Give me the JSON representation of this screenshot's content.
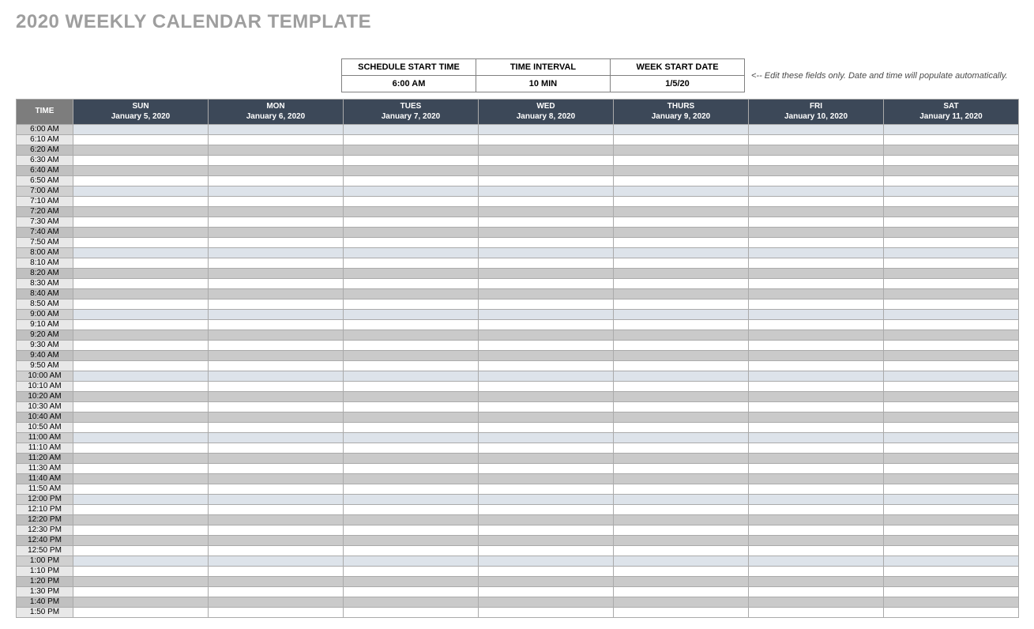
{
  "title": "2020 WEEKLY CALENDAR TEMPLATE",
  "config": {
    "headers": [
      "SCHEDULE START TIME",
      "TIME INTERVAL",
      "WEEK START DATE"
    ],
    "values": [
      "6:00 AM",
      "10 MIN",
      "1/5/20"
    ],
    "hint": "<-- Edit these fields only. Date and time will populate automatically."
  },
  "columns": [
    {
      "label": "TIME",
      "date": ""
    },
    {
      "label": "SUN",
      "date": "January 5, 2020"
    },
    {
      "label": "MON",
      "date": "January 6, 2020"
    },
    {
      "label": "TUES",
      "date": "January 7, 2020"
    },
    {
      "label": "WED",
      "date": "January 8, 2020"
    },
    {
      "label": "THURS",
      "date": "January 9, 2020"
    },
    {
      "label": "FRI",
      "date": "January 10, 2020"
    },
    {
      "label": "SAT",
      "date": "January 11, 2020"
    }
  ],
  "times": [
    "6:00 AM",
    "6:10 AM",
    "6:20 AM",
    "6:30 AM",
    "6:40 AM",
    "6:50 AM",
    "7:00 AM",
    "7:10 AM",
    "7:20 AM",
    "7:30 AM",
    "7:40 AM",
    "7:50 AM",
    "8:00 AM",
    "8:10 AM",
    "8:20 AM",
    "8:30 AM",
    "8:40 AM",
    "8:50 AM",
    "9:00 AM",
    "9:10 AM",
    "9:20 AM",
    "9:30 AM",
    "9:40 AM",
    "9:50 AM",
    "10:00 AM",
    "10:10 AM",
    "10:20 AM",
    "10:30 AM",
    "10:40 AM",
    "10:50 AM",
    "11:00 AM",
    "11:10 AM",
    "11:20 AM",
    "11:30 AM",
    "11:40 AM",
    "11:50 AM",
    "12:00 PM",
    "12:10 PM",
    "12:20 PM",
    "12:30 PM",
    "12:40 PM",
    "12:50 PM",
    "1:00 PM",
    "1:10 PM",
    "1:20 PM",
    "1:30 PM",
    "1:40 PM",
    "1:50 PM"
  ]
}
